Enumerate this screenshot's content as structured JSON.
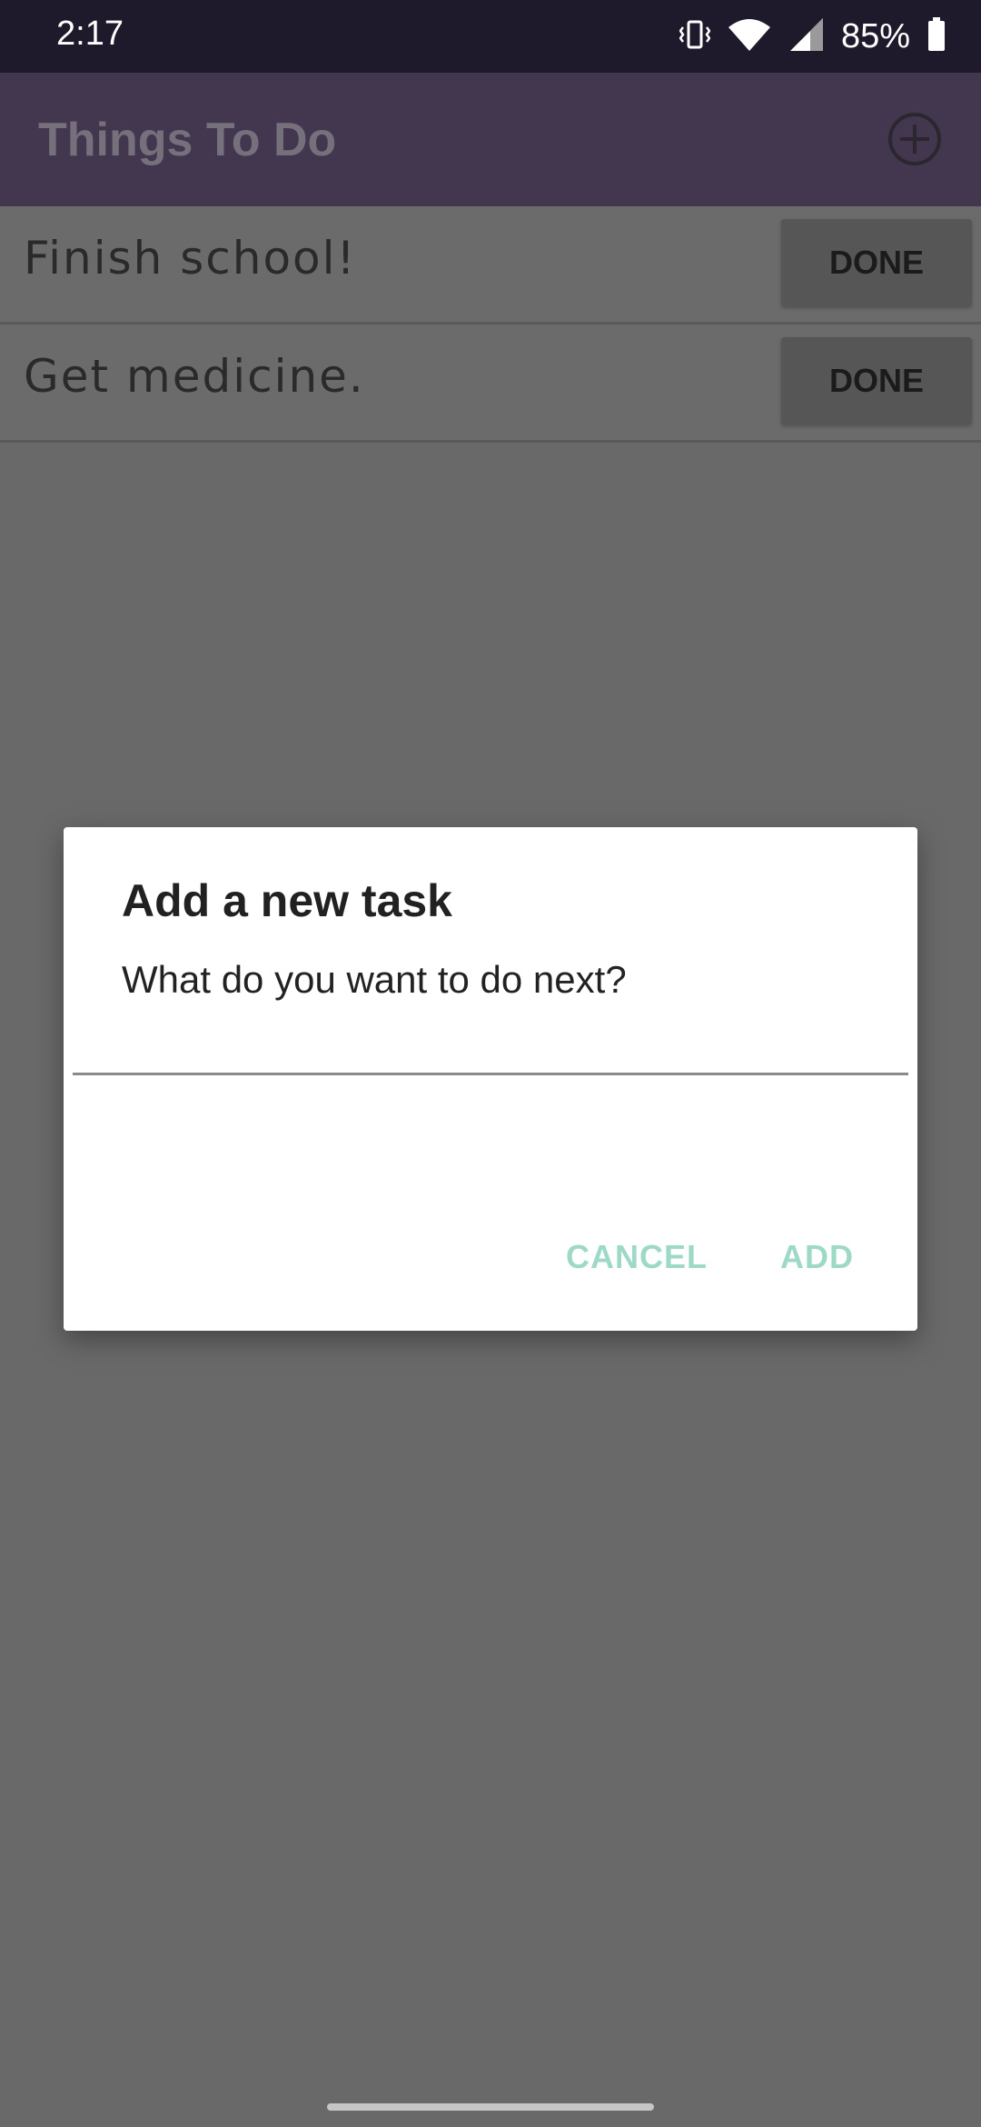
{
  "status_bar": {
    "time": "2:17",
    "battery_text": "85%",
    "icons": [
      "vibrate-icon",
      "wifi-icon",
      "signal-icon",
      "battery-icon"
    ]
  },
  "app_bar": {
    "title": "Things To Do",
    "add_icon": "add-circle-icon"
  },
  "tasks": [
    {
      "text": "Finish school!",
      "button": "DONE"
    },
    {
      "text": "Get medicine.",
      "button": "DONE"
    }
  ],
  "dialog": {
    "title": "Add a new task",
    "message": "What do you want to do next?",
    "input_value": "",
    "cancel_label": "CANCEL",
    "add_label": "ADD"
  },
  "colors": {
    "app_bar": "#42374f",
    "dialog_button": "#9ed9c7",
    "scrim": "#696969"
  }
}
